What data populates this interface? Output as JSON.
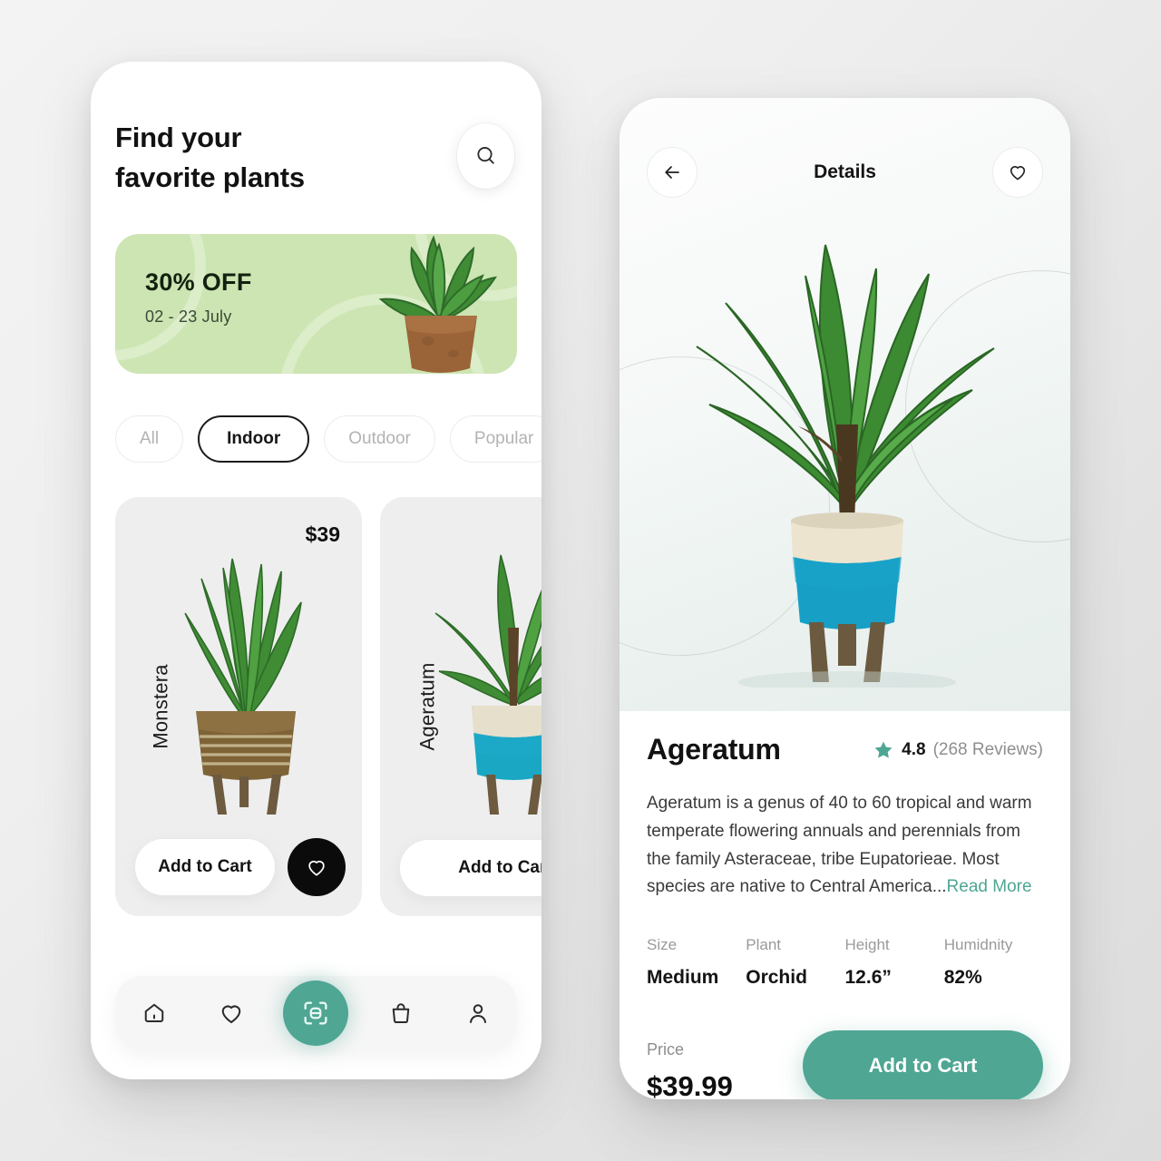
{
  "colors": {
    "accent_teal": "#4ea693",
    "banner_green": "#cce5b2",
    "dark": "#121212",
    "muted": "#8e8e90"
  },
  "home": {
    "title": "Find your\nfavorite plants",
    "search_icon": "search-icon",
    "promo": {
      "discount": "30% OFF",
      "dates": "02 - 23 July"
    },
    "filters": [
      {
        "label": "All",
        "active": false
      },
      {
        "label": "Indoor",
        "active": true
      },
      {
        "label": "Outdoor",
        "active": false
      },
      {
        "label": "Popular",
        "active": false
      }
    ],
    "products": [
      {
        "name": "Monstera",
        "price": "$39",
        "cta": "Add to Cart",
        "favorite_icon": "heart-icon"
      },
      {
        "name": "Ageratum",
        "price": "",
        "cta": "Add to Cart"
      }
    ],
    "tabs": [
      {
        "icon": "home-icon",
        "active": false
      },
      {
        "icon": "heart-icon",
        "active": false
      },
      {
        "icon": "scan-icon",
        "active": true
      },
      {
        "icon": "bag-icon",
        "active": false
      },
      {
        "icon": "person-icon",
        "active": false
      }
    ]
  },
  "detail": {
    "back_icon": "arrow-left-icon",
    "title": "Details",
    "favorite_icon": "heart-icon",
    "product": {
      "name": "Ageratum",
      "rating": "4.8",
      "reviews": "(268 Reviews)",
      "star_icon": "star-icon",
      "description": "Ageratum is a genus of 40 to 60 tropical and warm temperate flowering annuals and perennials from the family Asteraceae, tribe Eupatorieae. Most species are native to Central America...",
      "read_more": "Read More",
      "specs": [
        {
          "key": "Size",
          "value": "Medium"
        },
        {
          "key": "Plant",
          "value": "Orchid"
        },
        {
          "key": "Height",
          "value": "12.6”"
        },
        {
          "key": "Humidnity",
          "value": "82%"
        }
      ],
      "price_label": "Price",
      "price": "$39.99",
      "cta": "Add to Cart"
    }
  }
}
